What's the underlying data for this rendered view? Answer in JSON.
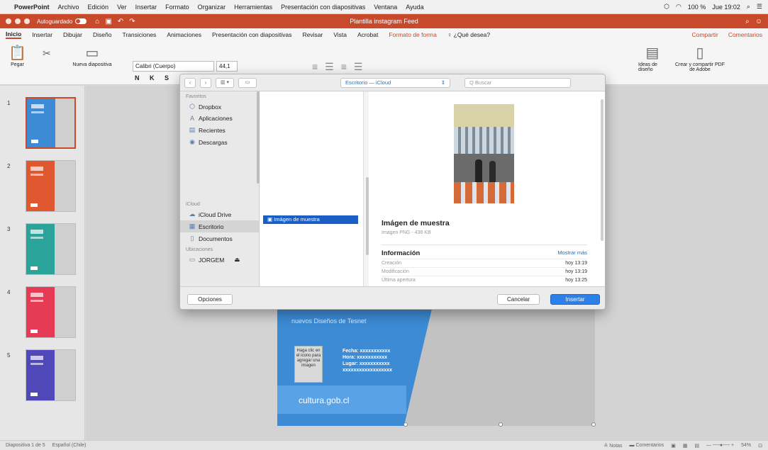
{
  "menubar": {
    "app_name": "PowerPoint",
    "items": [
      "Archivo",
      "Edición",
      "Ver",
      "Insertar",
      "Formato",
      "Organizar",
      "Herramientas",
      "Presentación con diapositivas",
      "Ventana",
      "Ayuda"
    ],
    "battery": "100 %",
    "clock": "Jue 19:02"
  },
  "titlebar": {
    "autosave_label": "Autoguardado",
    "autosave_state": "OFF",
    "title": "Plantilla instagram Feed"
  },
  "tabs": {
    "items": [
      "Inicio",
      "Insertar",
      "Dibujar",
      "Diseño",
      "Transiciones",
      "Animaciones",
      "Presentación con diapositivas",
      "Revisar",
      "Vista",
      "Acrobat",
      "Formato de forma"
    ],
    "active": "Inicio",
    "tell_me": "¿Qué desea?",
    "share": "Compartir",
    "comments": "Comentarios"
  },
  "ribbon": {
    "paste": "Pegar",
    "new_slide": "Nueva diapositiva",
    "font_name": "Calibri (Cuerpo)",
    "font_size": "44,1",
    "format_buttons": "N K S",
    "design_ideas": "Ideas de diseño",
    "create_pdf": "Crear y compartir PDF de Adobe"
  },
  "thumbnails": [
    {
      "number": "1",
      "color": "#3c8bd4",
      "selected": true
    },
    {
      "number": "2",
      "color": "#e0582f",
      "selected": false
    },
    {
      "number": "3",
      "color": "#2aa39b",
      "selected": false
    },
    {
      "number": "4",
      "color": "#e63b54",
      "selected": false
    },
    {
      "number": "5",
      "color": "#5048b8",
      "selected": false
    }
  ],
  "slide": {
    "subtitle": "nuevos Diseños de Tesnet",
    "image_placeholder": "Haga clic en el icono para agregar una imagen",
    "info_lines": [
      "Fecha: xxxxxxxxxxx",
      "Hora: xxxxxxxxxxx",
      "Lugar: xxxxxxxxxxx",
      "xxxxxxxxxxxxxxxxxx"
    ],
    "site": "cultura.gob.cl"
  },
  "dialog": {
    "location": "Escritorio — iCloud",
    "search_placeholder": "Q Buscar",
    "sidebar": {
      "favorites_header": "Favoritos",
      "favorites": [
        {
          "label": "Dropbox",
          "icon": "dropbox-icon"
        },
        {
          "label": "Aplicaciones",
          "icon": "applications-icon"
        },
        {
          "label": "Recientes",
          "icon": "recents-icon"
        },
        {
          "label": "Descargas",
          "icon": "downloads-icon"
        }
      ],
      "icloud_header": "iCloud",
      "icloud": [
        {
          "label": "iCloud Drive",
          "icon": "cloud-icon",
          "selected": false
        },
        {
          "label": "Escritorio",
          "icon": "desktop-icon",
          "selected": true
        },
        {
          "label": "Documentos",
          "icon": "documents-icon",
          "selected": false
        }
      ],
      "locations_header": "Ubicaciones",
      "locations": [
        {
          "label": "JORGEM",
          "icon": "disk-icon"
        }
      ]
    },
    "selected_file": "Imágen de muestra",
    "preview": {
      "name": "Imágen de muestra",
      "meta": "Imagen PNG - 436 KB",
      "info_header": "Información",
      "show_more": "Mostrar más",
      "rows": [
        {
          "key": "Creación",
          "value": "hoy 13:19"
        },
        {
          "key": "Modificación",
          "value": "hoy 13:19"
        },
        {
          "key": "Última apertura",
          "value": "hoy 13:25"
        }
      ]
    },
    "options_button": "Opciones",
    "cancel_button": "Cancelar",
    "insert_button": "Insertar"
  },
  "status": {
    "slide_info": "Diapositiva 1 de 5",
    "language": "Español (Chile)",
    "notes": "Notas",
    "comments": "Comentarios",
    "zoom": "54%"
  }
}
